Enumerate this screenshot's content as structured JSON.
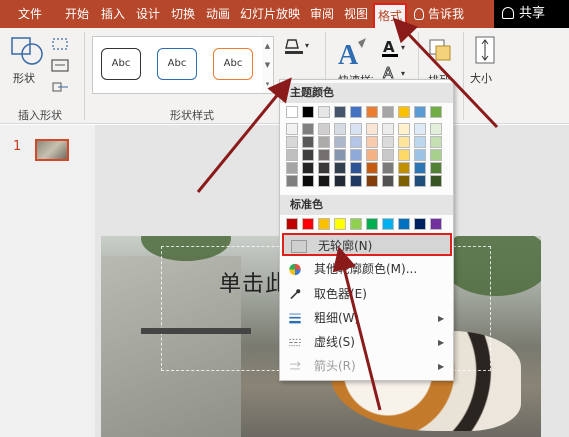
{
  "tabs": [
    {
      "label": "文件"
    },
    {
      "label": "开始"
    },
    {
      "label": "插入"
    },
    {
      "label": "设计"
    },
    {
      "label": "切换"
    },
    {
      "label": "动画"
    },
    {
      "label": "幻灯片放映"
    },
    {
      "label": "审阅"
    },
    {
      "label": "视图"
    },
    {
      "label": "格式"
    }
  ],
  "tellme": "告诉我",
  "share": "共享",
  "ribbon": {
    "shape_label": "形状",
    "insert_shapes_group": "插入形状",
    "shape_styles_group": "形状样式",
    "style_presets": [
      "Abc",
      "Abc",
      "Abc"
    ],
    "quick_styles": "快速样式",
    "arrange": "排列",
    "size": "大小"
  },
  "slide_thumb": {
    "number": "1"
  },
  "slide": {
    "title_fragment": "单击此"
  },
  "menu": {
    "theme_colors_label": "主题颜色",
    "standard_colors_label": "标准色",
    "theme_top_row": [
      "#ffffff",
      "#000000",
      "#e7e6e6",
      "#44546a",
      "#4472c4",
      "#ed7d31",
      "#a5a5a5",
      "#ffc000",
      "#5b9bd5",
      "#70ad47"
    ],
    "theme_shades": [
      [
        "#f2f2f2",
        "#7f7f7f",
        "#d0cece",
        "#d6dce4",
        "#d9e2f3",
        "#fbe5d5",
        "#ededed",
        "#fff2cc",
        "#deebf6",
        "#e2efd9"
      ],
      [
        "#d8d8d8",
        "#595959",
        "#aeaaaa",
        "#adb9ca",
        "#b4c6e7",
        "#f7cbac",
        "#dbdbdb",
        "#fee599",
        "#bdd7ee",
        "#c5e0b3"
      ],
      [
        "#bfbfbf",
        "#3f3f3f",
        "#757070",
        "#8496b0",
        "#8eaadb",
        "#f4b183",
        "#c9c9c9",
        "#ffd965",
        "#9cc3e5",
        "#a8d08d"
      ],
      [
        "#a5a5a5",
        "#262626",
        "#3a3838",
        "#323f4f",
        "#2f5496",
        "#c55a11",
        "#7b7b7b",
        "#bf9000",
        "#2e75b5",
        "#538135"
      ],
      [
        "#7f7f7f",
        "#0c0c0c",
        "#171616",
        "#222a35",
        "#1f3864",
        "#833c0b",
        "#525252",
        "#7f6000",
        "#1e4e79",
        "#375623"
      ]
    ],
    "standard_colors": [
      "#c00000",
      "#ff0000",
      "#ffc000",
      "#ffff00",
      "#92d050",
      "#00b050",
      "#00b0f0",
      "#0070c0",
      "#002060",
      "#7030a0"
    ],
    "items": {
      "no_outline": "无轮廓(N)",
      "more_colors": "其他轮廓颜色(M)...",
      "eyedropper": "取色器(E)",
      "weight": "粗细(W)",
      "dashes": "虚线(S)",
      "arrows": "箭头(R)"
    }
  },
  "colors": {
    "tab_bar": "#b7472a",
    "highlight_red": "#e0201a",
    "arrow": "#8b1a1a"
  }
}
